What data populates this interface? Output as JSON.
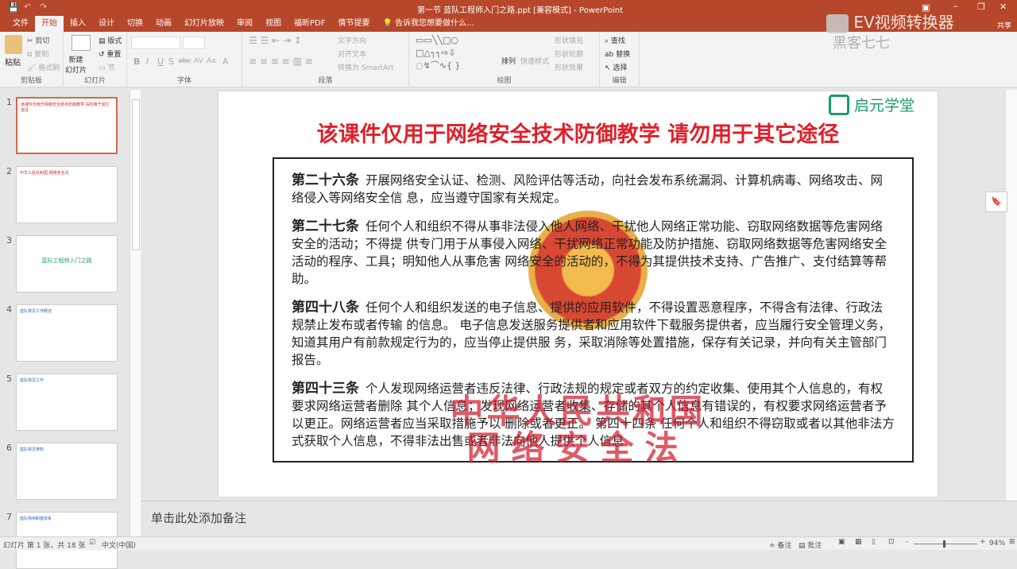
{
  "window": {
    "title": "第一节 蓝队工程师入门之路.ppt [兼容模式] - PowerPoint",
    "controls": [
      "restore-ribbon",
      "minimize",
      "maximize",
      "close"
    ]
  },
  "watermark_overlay": {
    "brand": "EV视频转换器",
    "user": "黑客七七",
    "share": "共享"
  },
  "tabs": [
    "文件",
    "开始",
    "插入",
    "设计",
    "切换",
    "动画",
    "幻灯片放映",
    "审阅",
    "视图",
    "福昕PDF",
    "情节提要"
  ],
  "tell_me": "告诉我您想要做什么...",
  "ribbon": {
    "clipboard": {
      "label": "剪贴板",
      "paste": "粘贴",
      "cut": "剪切",
      "copy": "复制",
      "format_painter": "格式刷"
    },
    "slides": {
      "label": "幻灯片",
      "new_slide": "新建\n幻灯片",
      "layout": "版式",
      "reset": "重置",
      "section": "节"
    },
    "font": {
      "label": "字体",
      "buttons": [
        "B",
        "I",
        "U",
        "S",
        "abc",
        "AV",
        "Aa",
        "A"
      ]
    },
    "paragraph": {
      "label": "段落",
      "text_direction": "文字方向",
      "align_text": "对齐文本",
      "smartart": "转换为 SmartArt"
    },
    "drawing": {
      "label": "绘图",
      "arrange": "排列",
      "quick_styles": "快速样式",
      "shape_fill": "形状填充",
      "shape_outline": "形状轮廓",
      "shape_effects": "形状效果"
    },
    "editing": {
      "label": "编辑",
      "find": "查找",
      "replace": "替换",
      "select": "选择"
    }
  },
  "thumbnails": [
    {
      "num": "1",
      "title": "该课件仅用于网络安全技术防御教学 请勿用于其它途径"
    },
    {
      "num": "2",
      "title": "中华人民共和国 网络安全法"
    },
    {
      "num": "3",
      "title": "蓝队工程师入门之路"
    },
    {
      "num": "4",
      "title": "蓝队常见工作概述"
    },
    {
      "num": "5",
      "title": "蓝队常见工作"
    },
    {
      "num": "6",
      "title": "蓝队常见架构"
    },
    {
      "num": "7",
      "title": "蓝队常用职能体系"
    }
  ],
  "slide": {
    "title": "该课件仅用于网络安全技术防御教学   请勿用于其它途径",
    "logo": "启元学堂",
    "articles": [
      {
        "head": "第二十六条",
        "body": "开展网络安全认证、检测、风险评估等活动，向社会发布系统漏洞、计算机病毒、网络攻击、网络侵入等网络安全信 息，应当遵守国家有关规定。"
      },
      {
        "head": "第二十七条",
        "body": "任何个人和组织不得从事非法侵入他人网络、干扰他人网络正常功能、窃取网络数据等危害网络安全的活动；不得提 供专门用于从事侵入网络、干扰网络正常功能及防护措施、窃取网络数据等危害网络安全活动的程序、工具；明知他人从事危害 网络安全的活动的，不得为其提供技术支持、广告推广、支付结算等帮助。"
      },
      {
        "head": "第四十八条",
        "body": "任何个人和组织发送的电子信息、提供的应用软件，不得设置恶意程序，不得含有法律、行政法规禁止发布或者传输 的信息。 电子信息发送服务提供者和应用软件下载服务提供者，应当履行安全管理义务，知道其用户有前款规定行为的，应当停止提供服 务，采取消除等处置措施，保存有关记录，并向有关主管部门报告。"
      },
      {
        "head": "第四十三条",
        "body": "个人发现网络运营者违反法律、行政法规的规定或者双方的约定收集、使用其个人信息的，有权要求网络运营者删除 其个人信息；发现网络运营者收集、存储的其个人信息有错误的，有权要求网络运营者予以更正。网络运营者应当采取措施予以 删除或者更正。 第四十四条  任何个人和组织不得窃取或者以其他非法方式获取个人信息，不得非法出售或者非法向他人提供个人信息"
      }
    ],
    "stamp_line1": "中华人民共和国",
    "stamp_line2": "网络安全法"
  },
  "notes_placeholder": "单击此处添加备注",
  "status": {
    "slide_info": "幻灯片 第 1 张，共 18 张",
    "language": "中文(中国)",
    "notes": "备注",
    "comments": "批注",
    "zoom": "94%"
  },
  "colors": {
    "accent": "#b7472a",
    "title_red": "#e0202a",
    "logo_green": "#1a9c6a"
  }
}
